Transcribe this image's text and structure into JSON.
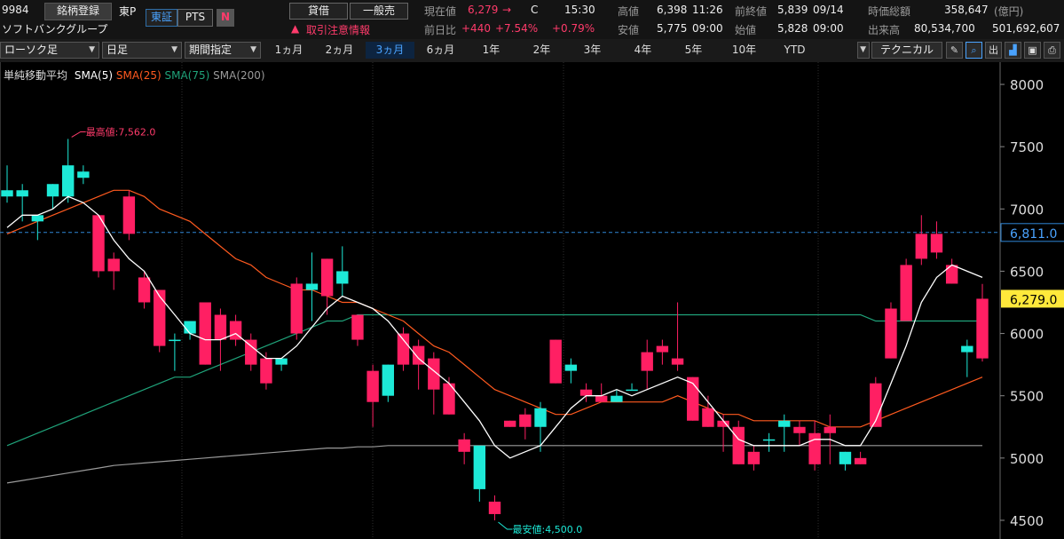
{
  "header": {
    "code": "9984",
    "register_btn": "銘柄登録",
    "market": "東P",
    "market_tab": "東証",
    "pts_tab": "PTS",
    "logo_letter": "N",
    "company": "ソフトバンクグループ",
    "credit_btn": "貸借",
    "general_btn": "一般売",
    "warning": "取引注意情報",
    "current_label": "現在値",
    "current_value": "6,279",
    "current_arrow": "→",
    "current_flag": "C",
    "current_time": "15:30",
    "prev_diff_label": "前日比",
    "prev_diff": "+440",
    "prev_diff_pct": "+7.54%",
    "prev_diff_pct2": "+0.79%",
    "high_label": "高値",
    "high_value": "6,398",
    "high_time": "11:26",
    "low_label": "安値",
    "low_value": "5,775",
    "low_time": "09:00",
    "prev_close_label": "前終値",
    "prev_close_value": "5,839",
    "prev_close_date": "09/14",
    "open_label": "始値",
    "open_value": "5,828",
    "open_time": "09:00",
    "mcap_label": "時価総額",
    "mcap_value": "358,647",
    "mcap_unit": "(億円)",
    "volume_label": "出来高",
    "volume_value": "80,534,700",
    "volume_value2": "501,692,607"
  },
  "toolbar": {
    "chart_type": "ローソク足",
    "timeframe": "日足",
    "period_mode": "期間指定",
    "periods": [
      "1ヵ月",
      "2ヵ月",
      "3ヵ月",
      "6ヵ月",
      "1年",
      "2年",
      "3年",
      "4年",
      "5年",
      "10年",
      "YTD"
    ],
    "active_period": "3ヵ月",
    "technical": "テクニカル",
    "out_label": "出"
  },
  "colors": {
    "up": "#1de9d7",
    "down": "#ff1f63",
    "sma5": "#ffffff",
    "sma25": "#ff5a1f",
    "sma75": "#1fa37a",
    "sma200": "#9a9a9a",
    "dashed": "#2f86d6"
  },
  "chart_data": {
    "type": "candlestick",
    "indicator_title": "単純移動平均",
    "legend": [
      "SMA(5)",
      "SMA(25)",
      "SMA(75)",
      "SMA(200)"
    ],
    "ylim": [
      4350,
      8150
    ],
    "yticks": [
      "8000",
      "7500",
      "7000",
      "6500",
      "6000",
      "5500",
      "5000",
      "4500"
    ],
    "yticks_values": [
      8000,
      7500,
      7000,
      6500,
      6000,
      5500,
      5000,
      4500
    ],
    "max_label": "最高値:7,562.0",
    "max_value": 7562,
    "min_label": "最安値:4,500.0",
    "min_value": 4500,
    "dashed_level": 6811,
    "dashed_label": "6,811.0",
    "current_level": 6279,
    "current_label": "6,279.0",
    "candles": [
      {
        "o": 7100,
        "h": 7350,
        "l": 7050,
        "c": 7150
      },
      {
        "o": 7100,
        "h": 7200,
        "l": 6900,
        "c": 7150
      },
      {
        "o": 6900,
        "h": 6950,
        "l": 6750,
        "c": 6950
      },
      {
        "o": 7100,
        "h": 7200,
        "l": 7000,
        "c": 7200
      },
      {
        "o": 7100,
        "h": 7562,
        "l": 7050,
        "c": 7350
      },
      {
        "o": 7250,
        "h": 7350,
        "l": 7200,
        "c": 7300
      },
      {
        "o": 6950,
        "h": 6950,
        "l": 6450,
        "c": 6500
      },
      {
        "o": 6600,
        "h": 6650,
        "l": 6350,
        "c": 6500
      },
      {
        "o": 7100,
        "h": 7150,
        "l": 6750,
        "c": 6800
      },
      {
        "o": 6450,
        "h": 6500,
        "l": 6200,
        "c": 6250
      },
      {
        "o": 6350,
        "h": 6350,
        "l": 5850,
        "c": 5900
      },
      {
        "o": 5950,
        "h": 6000,
        "l": 5700,
        "c": 5950
      },
      {
        "o": 6000,
        "h": 6050,
        "l": 5950,
        "c": 6100
      },
      {
        "o": 6250,
        "h": 6250,
        "l": 5750,
        "c": 5750
      },
      {
        "o": 6150,
        "h": 6200,
        "l": 5700,
        "c": 5950
      },
      {
        "o": 6100,
        "h": 6150,
        "l": 5900,
        "c": 5950
      },
      {
        "o": 5950,
        "h": 6000,
        "l": 5700,
        "c": 5750
      },
      {
        "o": 5800,
        "h": 5850,
        "l": 5550,
        "c": 5600
      },
      {
        "o": 5750,
        "h": 5800,
        "l": 5700,
        "c": 5800
      },
      {
        "o": 6400,
        "h": 6450,
        "l": 5950,
        "c": 6000
      },
      {
        "o": 6350,
        "h": 6650,
        "l": 6100,
        "c": 6400
      },
      {
        "o": 6600,
        "h": 6600,
        "l": 6150,
        "c": 6300
      },
      {
        "o": 6400,
        "h": 6700,
        "l": 6300,
        "c": 6500
      },
      {
        "o": 6150,
        "h": 6150,
        "l": 5900,
        "c": 5950
      },
      {
        "o": 5700,
        "h": 5750,
        "l": 5250,
        "c": 5450
      },
      {
        "o": 5500,
        "h": 5750,
        "l": 5450,
        "c": 5750
      },
      {
        "o": 6000,
        "h": 6050,
        "l": 5700,
        "c": 5750
      },
      {
        "o": 5900,
        "h": 5950,
        "l": 5550,
        "c": 5750
      },
      {
        "o": 5800,
        "h": 5850,
        "l": 5350,
        "c": 5550
      },
      {
        "o": 5600,
        "h": 5650,
        "l": 5350,
        "c": 5350
      },
      {
        "o": 5150,
        "h": 5200,
        "l": 4950,
        "c": 5050
      },
      {
        "o": 4750,
        "h": 5050,
        "l": 4650,
        "c": 5100
      },
      {
        "o": 4650,
        "h": 4700,
        "l": 4500,
        "c": 4550
      },
      {
        "o": 5300,
        "h": 5300,
        "l": 5250,
        "c": 5250
      },
      {
        "o": 5350,
        "h": 5400,
        "l": 5150,
        "c": 5250
      },
      {
        "o": 5250,
        "h": 5450,
        "l": 5050,
        "c": 5400
      },
      {
        "o": 5950,
        "h": 5950,
        "l": 5600,
        "c": 5600
      },
      {
        "o": 5700,
        "h": 5800,
        "l": 5600,
        "c": 5750
      },
      {
        "o": 5550,
        "h": 5600,
        "l": 5450,
        "c": 5500
      },
      {
        "o": 5500,
        "h": 5600,
        "l": 5450,
        "c": 5450
      },
      {
        "o": 5450,
        "h": 5550,
        "l": 5450,
        "c": 5500
      },
      {
        "o": 5550,
        "h": 5600,
        "l": 5550,
        "c": 5550
      },
      {
        "o": 5850,
        "h": 5950,
        "l": 5550,
        "c": 5700
      },
      {
        "o": 5900,
        "h": 5950,
        "l": 5750,
        "c": 5850
      },
      {
        "o": 5800,
        "h": 6250,
        "l": 5700,
        "c": 5750
      },
      {
        "o": 5650,
        "h": 5650,
        "l": 5300,
        "c": 5300
      },
      {
        "o": 5400,
        "h": 5500,
        "l": 5250,
        "c": 5250
      },
      {
        "o": 5300,
        "h": 5350,
        "l": 5050,
        "c": 5250
      },
      {
        "o": 5250,
        "h": 5300,
        "l": 4950,
        "c": 4950
      },
      {
        "o": 5050,
        "h": 5100,
        "l": 4900,
        "c": 4950
      },
      {
        "o": 5150,
        "h": 5200,
        "l": 5050,
        "c": 5150
      },
      {
        "o": 5250,
        "h": 5350,
        "l": 5050,
        "c": 5300
      },
      {
        "o": 5250,
        "h": 5300,
        "l": 5100,
        "c": 5200
      },
      {
        "o": 5200,
        "h": 5300,
        "l": 4900,
        "c": 4950
      },
      {
        "o": 5250,
        "h": 5350,
        "l": 4950,
        "c": 5200
      },
      {
        "o": 4950,
        "h": 5050,
        "l": 4900,
        "c": 5050
      },
      {
        "o": 5000,
        "h": 5050,
        "l": 4950,
        "c": 4950
      },
      {
        "o": 5600,
        "h": 5650,
        "l": 5250,
        "c": 5250
      },
      {
        "o": 6200,
        "h": 6250,
        "l": 5800,
        "c": 5800
      },
      {
        "o": 6550,
        "h": 6600,
        "l": 6100,
        "c": 6100
      },
      {
        "o": 6800,
        "h": 6950,
        "l": 6550,
        "c": 6600
      },
      {
        "o": 6800,
        "h": 6900,
        "l": 6600,
        "c": 6650
      },
      {
        "o": 6550,
        "h": 6600,
        "l": 6400,
        "c": 6400
      },
      {
        "o": 5850,
        "h": 5950,
        "l": 5650,
        "c": 5900
      },
      {
        "o": 6279,
        "h": 6398,
        "l": 5775,
        "c": 5800
      }
    ],
    "sma5": [
      6850,
      6950,
      6950,
      7000,
      7100,
      7050,
      6950,
      6750,
      6600,
      6500,
      6300,
      6150,
      6000,
      5950,
      5950,
      6000,
      5900,
      5800,
      5800,
      5900,
      6050,
      6200,
      6300,
      6250,
      6200,
      6100,
      5950,
      5800,
      5700,
      5600,
      5450,
      5300,
      5100,
      5000,
      5050,
      5100,
      5250,
      5400,
      5500,
      5500,
      5550,
      5500,
      5550,
      5600,
      5650,
      5600,
      5450,
      5300,
      5150,
      5100,
      5100,
      5100,
      5100,
      5150,
      5150,
      5100,
      5100,
      5300,
      5600,
      5900,
      6250,
      6450,
      6550,
      6500,
      6450
    ],
    "sma25": [
      6800,
      6850,
      6900,
      6950,
      7000,
      7050,
      7100,
      7150,
      7150,
      7100,
      7000,
      6950,
      6900,
      6800,
      6700,
      6600,
      6550,
      6450,
      6400,
      6350,
      6350,
      6300,
      6250,
      6250,
      6200,
      6150,
      6100,
      6000,
      5900,
      5850,
      5750,
      5650,
      5550,
      5500,
      5450,
      5400,
      5350,
      5350,
      5400,
      5450,
      5450,
      5450,
      5450,
      5450,
      5500,
      5450,
      5400,
      5350,
      5350,
      5300,
      5300,
      5300,
      5300,
      5300,
      5250,
      5250,
      5250,
      5300,
      5350,
      5400,
      5450,
      5500,
      5550,
      5600,
      5650
    ],
    "sma75": [
      5100,
      5150,
      5200,
      5250,
      5300,
      5350,
      5400,
      5450,
      5500,
      5550,
      5600,
      5650,
      5650,
      5700,
      5750,
      5800,
      5850,
      5900,
      5950,
      6000,
      6050,
      6100,
      6100,
      6150,
      6150,
      6150,
      6150,
      6150,
      6150,
      6150,
      6150,
      6150,
      6150,
      6150,
      6150,
      6150,
      6150,
      6150,
      6150,
      6150,
      6150,
      6150,
      6150,
      6150,
      6150,
      6150,
      6150,
      6150,
      6150,
      6150,
      6150,
      6150,
      6150,
      6150,
      6150,
      6150,
      6150,
      6100,
      6100,
      6100,
      6100,
      6100,
      6100,
      6100,
      6100
    ],
    "sma200": [
      4800,
      4820,
      4840,
      4860,
      4880,
      4900,
      4920,
      4940,
      4950,
      4960,
      4970,
      4980,
      4990,
      5000,
      5010,
      5020,
      5030,
      5040,
      5050,
      5060,
      5070,
      5080,
      5080,
      5090,
      5090,
      5100,
      5100,
      5100,
      5100,
      5100,
      5100,
      5100,
      5100,
      5100,
      5100,
      5100,
      5100,
      5100,
      5100,
      5100,
      5100,
      5100,
      5100,
      5100,
      5100,
      5100,
      5100,
      5100,
      5100,
      5100,
      5100,
      5100,
      5100,
      5100,
      5100,
      5100,
      5100,
      5100,
      5100,
      5100,
      5100,
      5100,
      5100,
      5100,
      5100
    ]
  }
}
